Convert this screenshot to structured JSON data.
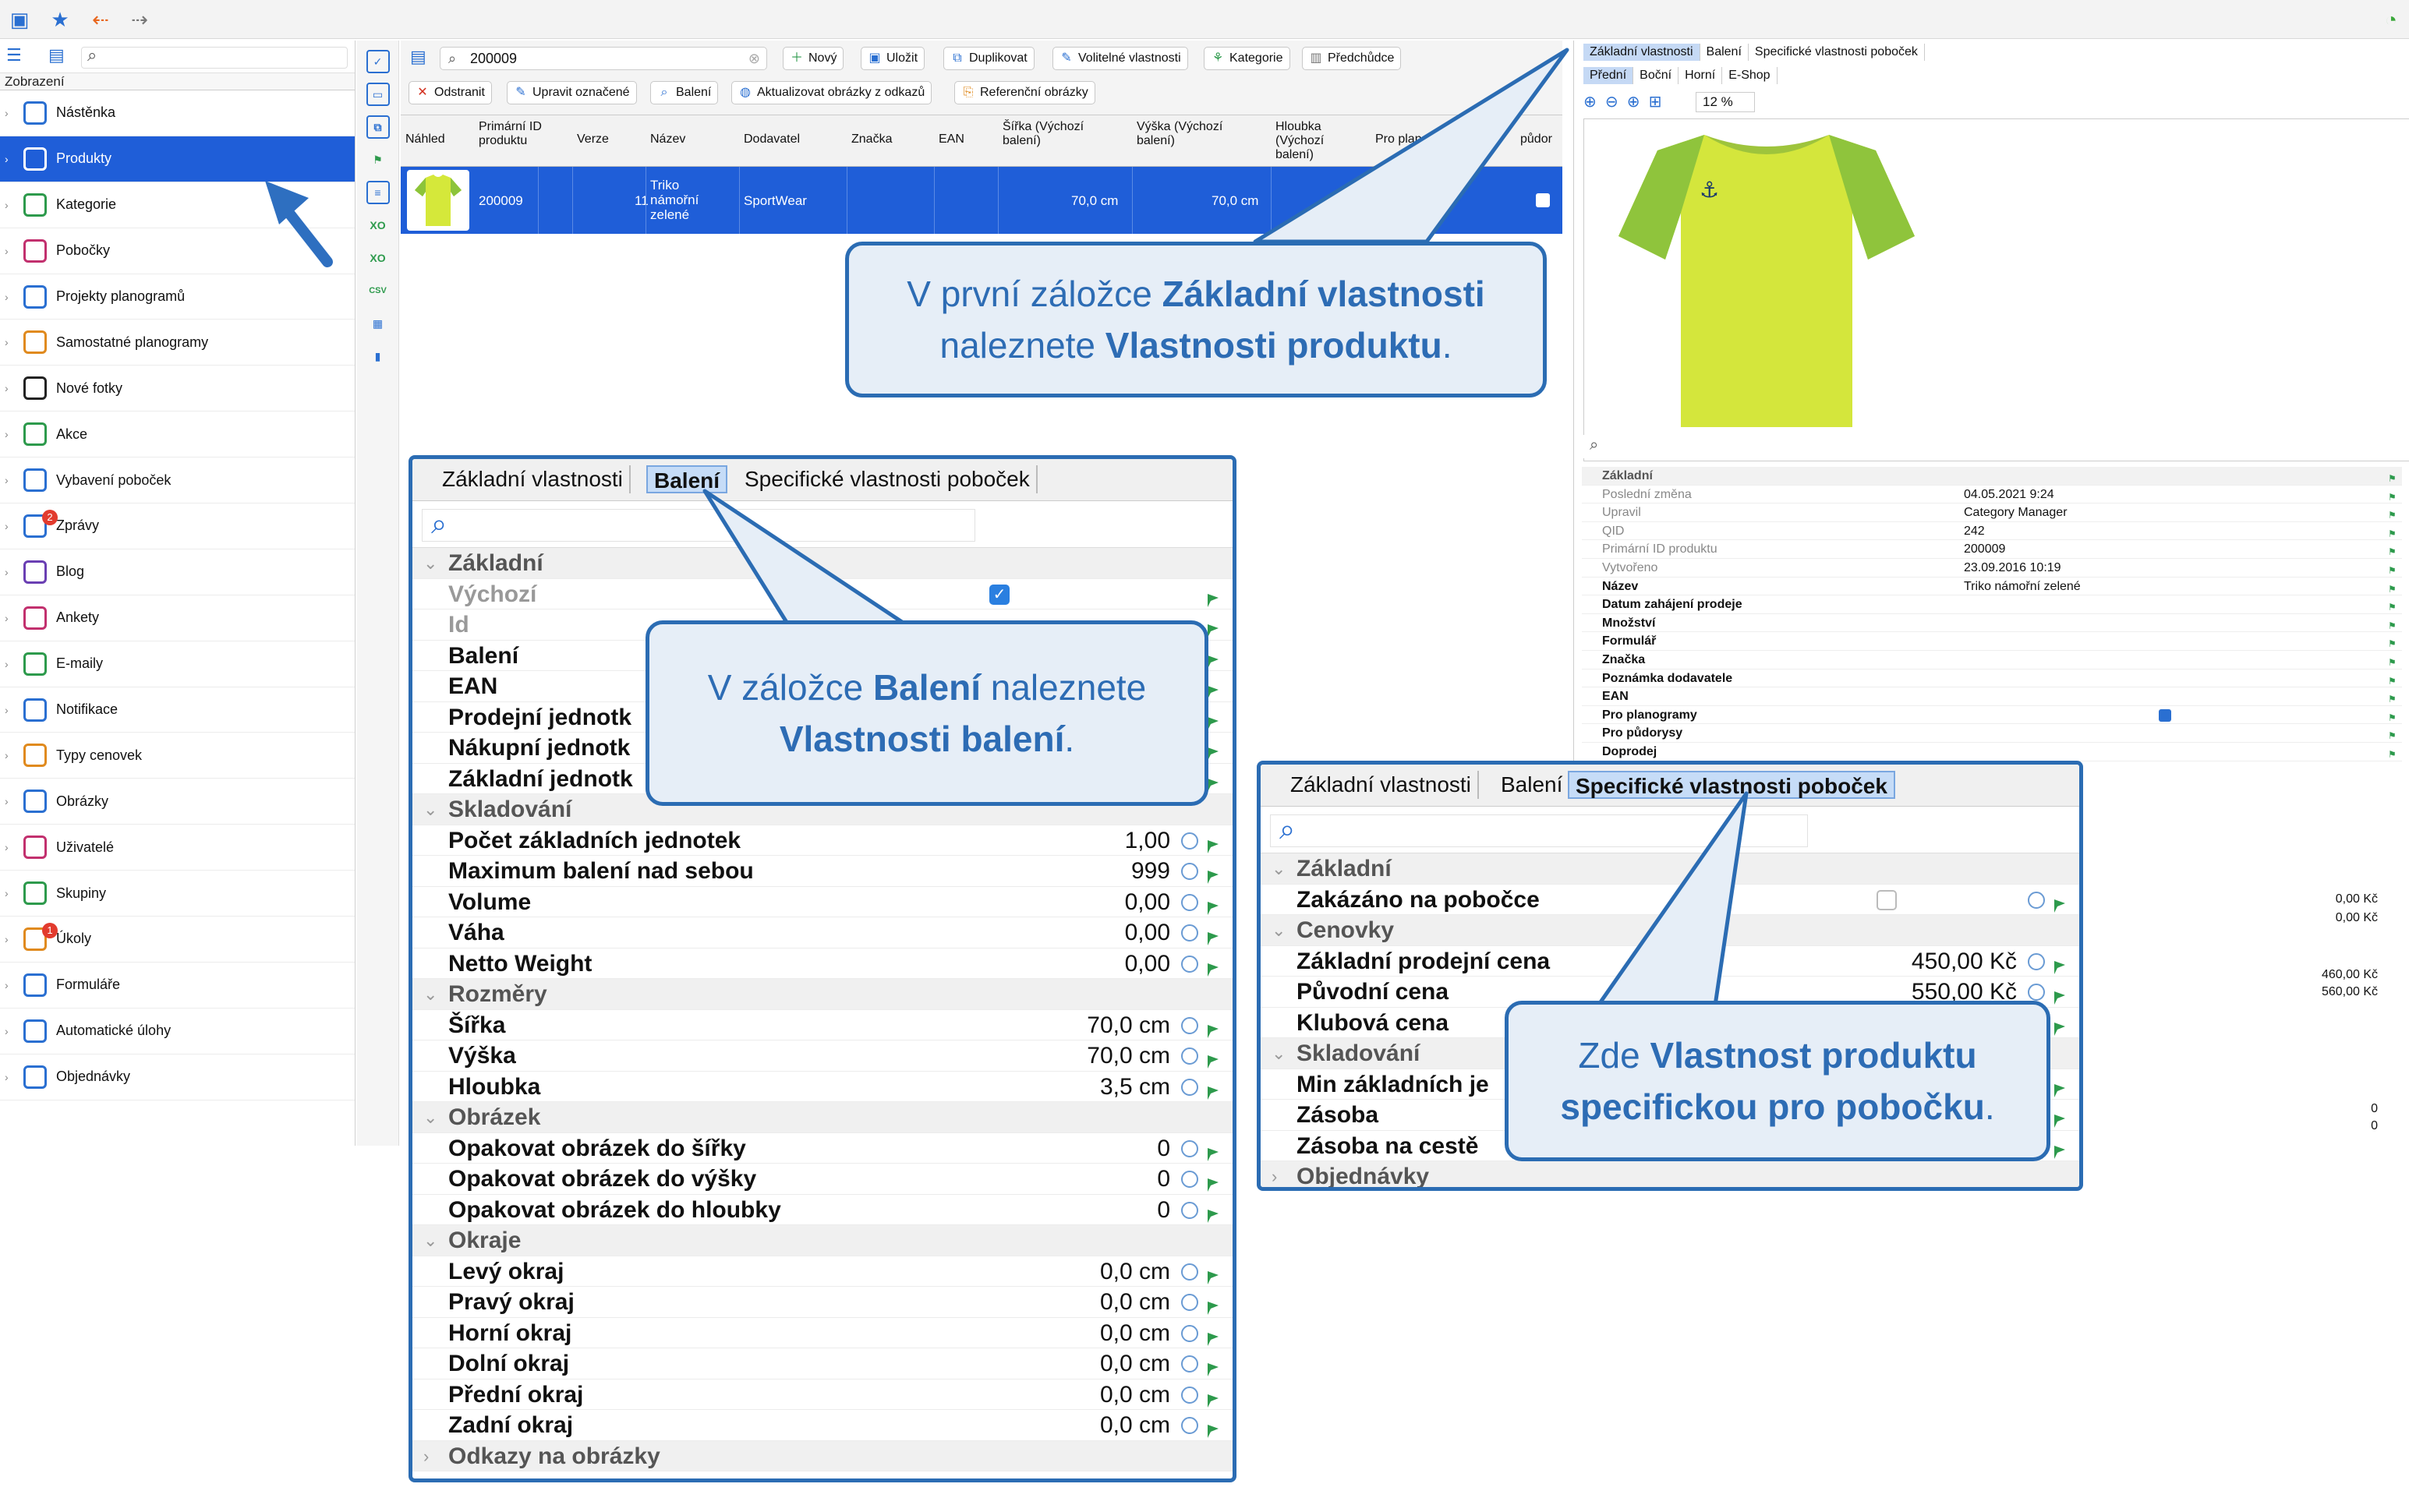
{
  "sidebar": {
    "section_label": "Zobrazení",
    "items": [
      {
        "label": "Nástěnka",
        "icon": "dashboard-icon"
      },
      {
        "label": "Produkty",
        "icon": "products-icon",
        "selected": true
      },
      {
        "label": "Kategorie",
        "icon": "categories-icon"
      },
      {
        "label": "Pobočky",
        "icon": "stores-icon"
      },
      {
        "label": "Projekty planogramů",
        "icon": "planogram-projects-icon"
      },
      {
        "label": "Samostatné planogramy",
        "icon": "planograms-icon"
      },
      {
        "label": "Nové fotky",
        "icon": "camera-icon"
      },
      {
        "label": "Akce",
        "icon": "promotions-icon"
      },
      {
        "label": "Vybavení poboček",
        "icon": "fixtures-icon"
      },
      {
        "label": "Zprávy",
        "icon": "messages-icon",
        "badge": "2"
      },
      {
        "label": "Blog",
        "icon": "blog-icon"
      },
      {
        "label": "Ankety",
        "icon": "surveys-icon"
      },
      {
        "label": "E-maily",
        "icon": "email-icon"
      },
      {
        "label": "Notifikace",
        "icon": "notification-icon"
      },
      {
        "label": "Typy cenovek",
        "icon": "price-tag-icon"
      },
      {
        "label": "Obrázky",
        "icon": "images-icon"
      },
      {
        "label": "Uživatelé",
        "icon": "users-icon"
      },
      {
        "label": "Skupiny",
        "icon": "groups-icon"
      },
      {
        "label": "Úkoly",
        "icon": "tasks-icon",
        "badge": "1"
      },
      {
        "label": "Formuláře",
        "icon": "forms-icon"
      },
      {
        "label": "Automatické úlohy",
        "icon": "auto-tasks-icon"
      },
      {
        "label": "Objednávky",
        "icon": "orders-icon"
      }
    ]
  },
  "toolbar": {
    "search_value": "200009",
    "new": "Nový",
    "save": "Uložit",
    "duplicate": "Duplikovat",
    "optional_props": "Volitelné vlastnosti",
    "category": "Kategorie",
    "predecessor": "Předchůdce",
    "delete": "Odstranit",
    "edit_marked": "Upravit označené",
    "packaging": "Balení",
    "update_images": "Aktualizovat obrázky z odkazů",
    "reference_images": "Referenční obrázky"
  },
  "table": {
    "headers": [
      "Náhled",
      "Primární ID produktu",
      "Verze",
      "Název",
      "Dodavatel",
      "Značka",
      "EAN",
      "Šířka (Výchozí balení)",
      "Výška (Výchozí balení)",
      "Hloubka (Výchozí balení)",
      "Pro planog",
      "půdor"
    ],
    "row": {
      "id": "200009",
      "version": "11",
      "name": "Triko námořní zelené",
      "supplier": "SportWear",
      "width": "70,0 cm",
      "height": "70,0 cm"
    }
  },
  "right_panel": {
    "tabs": [
      "Základní vlastnosti",
      "Balení",
      "Specifické vlastnosti poboček"
    ],
    "view_tabs": [
      "Přední",
      "Boční",
      "Horní",
      "E-Shop"
    ],
    "zoom": "12 %",
    "props": [
      {
        "k": "Základní",
        "v": "",
        "group": true
      },
      {
        "k": "Poslední změna",
        "v": "04.05.2021 9:24",
        "muted": true
      },
      {
        "k": "Upravil",
        "v": "Category Manager",
        "muted": true
      },
      {
        "k": "QID",
        "v": "242",
        "muted": true
      },
      {
        "k": "Primární ID produktu",
        "v": "200009",
        "muted": true
      },
      {
        "k": "Vytvořeno",
        "v": "23.09.2016 10:19",
        "muted": true
      },
      {
        "k": "Název",
        "v": "Triko námořní zelené"
      },
      {
        "k": "Datum zahájení prodeje",
        "v": ""
      },
      {
        "k": "Množství",
        "v": ""
      },
      {
        "k": "Formulář",
        "v": ""
      },
      {
        "k": "Značka",
        "v": ""
      },
      {
        "k": "Poznámka dodavatele",
        "v": ""
      },
      {
        "k": "EAN",
        "v": ""
      },
      {
        "k": "Pro planogramy",
        "v": ""
      },
      {
        "k": "Pro půdorysy",
        "v": ""
      },
      {
        "k": "Doprodej",
        "v": ""
      }
    ],
    "side_values": [
      "0,00 Kč",
      "0,00 Kč",
      "460,00 Kč",
      "560,00 Kč",
      "0",
      "0"
    ]
  },
  "packaging_panel": {
    "tabs": [
      "Základní vlastnosti",
      "Balení",
      "Specifické vlastnosti poboček"
    ],
    "rows": [
      {
        "k": "Základní",
        "group": true
      },
      {
        "k": "Výchozí",
        "check": true,
        "muted": true
      },
      {
        "k": "Id",
        "muted": true
      },
      {
        "k": "Balení"
      },
      {
        "k": "EAN"
      },
      {
        "k": "Prodejní jednotk"
      },
      {
        "k": "Nákupní jednotk"
      },
      {
        "k": "Základní jednotk"
      },
      {
        "k": "Skladování",
        "group": true
      },
      {
        "k": "Počet základních jednotek",
        "v": "1,00"
      },
      {
        "k": "Maximum balení nad sebou",
        "v": "999"
      },
      {
        "k": "Volume",
        "v": "0,00"
      },
      {
        "k": "Váha",
        "v": "0,00"
      },
      {
        "k": "Netto Weight",
        "v": "0,00"
      },
      {
        "k": "Rozměry",
        "group": true
      },
      {
        "k": "Šířka",
        "v": "70,0 cm"
      },
      {
        "k": "Výška",
        "v": "70,0 cm"
      },
      {
        "k": "Hloubka",
        "v": "3,5 cm"
      },
      {
        "k": "Obrázek",
        "group": true
      },
      {
        "k": "Opakovat obrázek do šířky",
        "v": "0"
      },
      {
        "k": "Opakovat obrázek do výšky",
        "v": "0"
      },
      {
        "k": "Opakovat obrázek do hloubky",
        "v": "0"
      },
      {
        "k": "Okraje",
        "group": true
      },
      {
        "k": "Levý okraj",
        "v": "0,0 cm"
      },
      {
        "k": "Pravý okraj",
        "v": "0,0 cm"
      },
      {
        "k": "Horní okraj",
        "v": "0,0 cm"
      },
      {
        "k": "Dolní okraj",
        "v": "0,0 cm"
      },
      {
        "k": "Přední okraj",
        "v": "0,0 cm"
      },
      {
        "k": "Zadní okraj",
        "v": "0,0 cm"
      },
      {
        "k": "Odkazy na obrázky",
        "group": true,
        "collapsed": true
      }
    ]
  },
  "store_panel": {
    "tabs": [
      "Základní vlastnosti",
      "Balení",
      "Specifické vlastnosti poboček"
    ],
    "rows": [
      {
        "k": "Základní",
        "group": true
      },
      {
        "k": "Zakázáno na pobočce",
        "checkbox": true
      },
      {
        "k": "Cenovky",
        "group": true
      },
      {
        "k": "Základní prodejní cena",
        "v": "450,00 Kč"
      },
      {
        "k": "Původní cena",
        "v": "550,00 Kč"
      },
      {
        "k": "Klubová cena"
      },
      {
        "k": "Skladování",
        "group": true
      },
      {
        "k": "Min základních je"
      },
      {
        "k": "Zásoba"
      },
      {
        "k": "Zásoba na cestě"
      },
      {
        "k": "Objednávky",
        "group": true,
        "collapsed": true
      }
    ]
  },
  "callouts": {
    "c1_pre": "V první záložce ",
    "c1_b1": "Základní vlastnosti",
    "c1_mid": "naleznete ",
    "c1_b2": "Vlastnosti produktu",
    "c1_post": ".",
    "c2_pre": "V záložce ",
    "c2_b1": "Balení",
    "c2_mid": " naleznete",
    "c2_b2": "Vlastnosti balení",
    "c2_post": ".",
    "c3_pre": "Zde ",
    "c3_b1": "Vlastnost produktu",
    "c3_b2": "specifickou pro pobočku",
    "c3_post": "."
  },
  "colors": {
    "accent": "#1f5ed8",
    "callout_border": "#2b6cb3",
    "callout_bg": "#e6eef7",
    "callout_text": "#2d6cb4"
  }
}
